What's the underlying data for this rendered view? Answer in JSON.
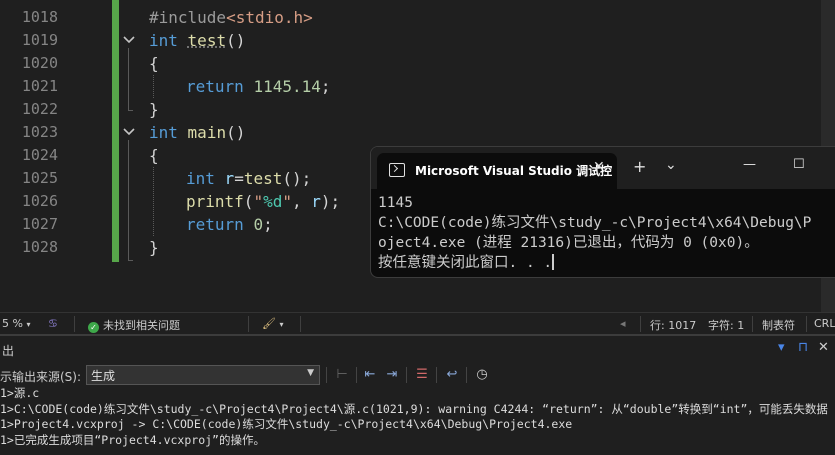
{
  "editor": {
    "line_numbers": [
      "1018",
      "1019",
      "1020",
      "1021",
      "1022",
      "1023",
      "1024",
      "1025",
      "1026",
      "1027",
      "1028"
    ],
    "code": {
      "l1018_include": "#include",
      "l1018_header": "<stdio.h>",
      "l1019_kw": "int",
      "l1019_fn": "test",
      "l1019_paren": "()",
      "l1020": "{",
      "l1021_kw": "return",
      "l1021_num": "1145.14",
      "l1021_semi": ";",
      "l1022": "}",
      "l1023_kw": "int",
      "l1023_fn": "main",
      "l1023_paren": "()",
      "l1024": "{",
      "l1025_kw": "int",
      "l1025_var": "r",
      "l1025_eq": "=",
      "l1025_fn": "test",
      "l1025_rest": "();",
      "l1026_fn": "printf",
      "l1026_open": "(",
      "l1026_q1": "\"",
      "l1026_fmt": "%d",
      "l1026_q2": "\"",
      "l1026_comma": ", ",
      "l1026_var": "r",
      "l1026_close": ");",
      "l1027_kw": "return",
      "l1027_num": "0",
      "l1027_semi": ";",
      "l1028": "}"
    }
  },
  "console": {
    "title": "Microsoft Visual Studio 调试控",
    "close_glyph": "✕",
    "new_tab_glyph": "+",
    "dropdown_glyph": "⌄",
    "minimize_glyph": "—",
    "maximize_glyph": "☐",
    "lines": [
      "1145",
      "C:\\CODE(code)练习文件\\study_-c\\Project4\\x64\\Debug\\P",
      "oject4.exe (进程 21316)已退出，代码为 0 (0x0)。",
      "按任意键关闭此窗口. . ."
    ]
  },
  "status_strip": {
    "zoom": "5 %",
    "issues": "未找到相关问题",
    "line": "行: 1017",
    "char": "字符: 1",
    "tabs": "制表符",
    "eol": "CRL"
  },
  "output": {
    "title": "出",
    "source_label": "示输出来源(S):",
    "source_value": "生成",
    "lines": [
      "1>源.c",
      "1>C:\\CODE(code)练习文件\\study_-c\\Project4\\Project4\\源.c(1021,9): warning C4244: “return”: 从“double”转换到“int”，可能丢失数据",
      "1>Project4.vcxproj -> C:\\CODE(code)练习文件\\study_-c\\Project4\\x64\\Debug\\Project4.exe",
      "1>已完成生成项目“Project4.vcxproj”的操作。"
    ]
  },
  "colors": {
    "editor_bg": "#1f1f1f",
    "keyword": "#569cd6",
    "function": "#dcdcaa",
    "number": "#b5cea8",
    "string": "#d69d85",
    "change_bar": "#57a64a"
  }
}
